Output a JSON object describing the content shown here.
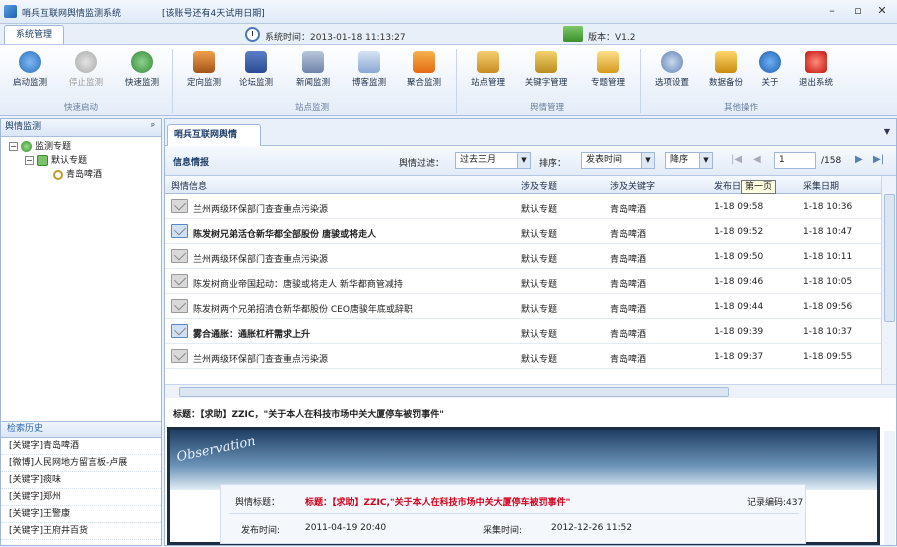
{
  "window": {
    "title": "哨兵互联网舆情监测系统",
    "trial": "[该账号还有4天试用日期]"
  },
  "controls": {
    "minimize": "–",
    "restore": "▫",
    "close": "✕"
  },
  "sysbar": {
    "tab": "系统管理",
    "time": "系统时间：2013-01-18 11:13:27",
    "version": "版本：V1.2"
  },
  "ribbon": {
    "buttons": [
      "启动监测",
      "停止监测",
      "快速监测",
      "定向监测",
      "论坛监测",
      "新闻监测",
      "博客监测",
      "聚合监测",
      "站点管理",
      "关键字管理",
      "专题管理",
      "选项设置",
      "数据备份",
      "关于",
      "退出系统"
    ],
    "groups": [
      "快速启动",
      "站点监测",
      "舆情管理",
      "其他操作"
    ]
  },
  "left": {
    "header": "舆情监测",
    "pin": "ᵖ",
    "tree": {
      "root": "监测专题",
      "child": "默认专题",
      "leaf": "青岛啤酒"
    },
    "history_header": "检索历史",
    "history": [
      "[关键字]青岛啤酒",
      "[微博]人民网地方留言板-卢展",
      "[关键字]痰味",
      "[关键字]郑州",
      "[关键字]王警康",
      "[关键字]王府井百货"
    ]
  },
  "main": {
    "tab": "哨兵互联网舆情",
    "filter": {
      "title": "信息情报",
      "label": "舆情过滤：",
      "period": "过去三月",
      "sort_label": "排序：",
      "sort_field": "发表时间",
      "order": "降序",
      "page": "1",
      "total": "/158"
    },
    "columns": [
      "舆情信息",
      "涉及专题",
      "涉及关键字",
      "发布日期",
      "采集日期"
    ],
    "rows": [
      {
        "title": "兰州两级环保部门查查重点污染源",
        "topic": "默认专题",
        "kw": "青岛啤酒",
        "pub": "1-18 09:58",
        "col": "1-18 10:36",
        "bold": false
      },
      {
        "title": "陈发树兄弟活仓新华都全部股份 唐骏或将走人",
        "topic": "默认专题",
        "kw": "青岛啤酒",
        "pub": "1-18 09:52",
        "col": "1-18 10:47",
        "bold": true
      },
      {
        "title": "兰州两级环保部门查查重点污染源",
        "topic": "默认专题",
        "kw": "青岛啤酒",
        "pub": "1-18 09:50",
        "col": "1-18 10:11",
        "bold": false
      },
      {
        "title": "陈发树商业帝国起动：唐骏或将走人 新华都商管减持",
        "topic": "默认专题",
        "kw": "青岛啤酒",
        "pub": "1-18 09:46",
        "col": "1-18 10:05",
        "bold": false
      },
      {
        "title": "陈发树两个兄弟招清仓新华都股份 CEO唐骏年底或辞职",
        "topic": "默认专题",
        "kw": "青岛啤酒",
        "pub": "1-18 09:44",
        "col": "1-18 09:56",
        "bold": false
      },
      {
        "title": "雾合通胀：通胀杠杆需求上升",
        "topic": "默认专题",
        "kw": "青岛啤酒",
        "pub": "1-18 09:39",
        "col": "1-18 10:37",
        "bold": true
      },
      {
        "title": "兰州两级环保部门查查重点污染源",
        "topic": "默认专题",
        "kw": "青岛啤酒",
        "pub": "1-18 09:37",
        "col": "1-18 09:55",
        "bold": false
      }
    ],
    "tooltip": "第一页",
    "detail": {
      "title_line": "标题：【求助】ZZIC，\"关于本人在科技市场中关大厦停车被罚事件\"",
      "obs_word": "Observation",
      "label_title": "舆情标题：",
      "value_title": "标题：【求助】ZZIC,\"关于本人在科技市场中关大厦停车被罚事件\"",
      "record": "记录编码:437",
      "label_pub": "发布时间:",
      "value_pub": "2011-04-19 20:40",
      "label_col": "采集时间:",
      "value_col": "2012-12-26 11:52"
    }
  }
}
